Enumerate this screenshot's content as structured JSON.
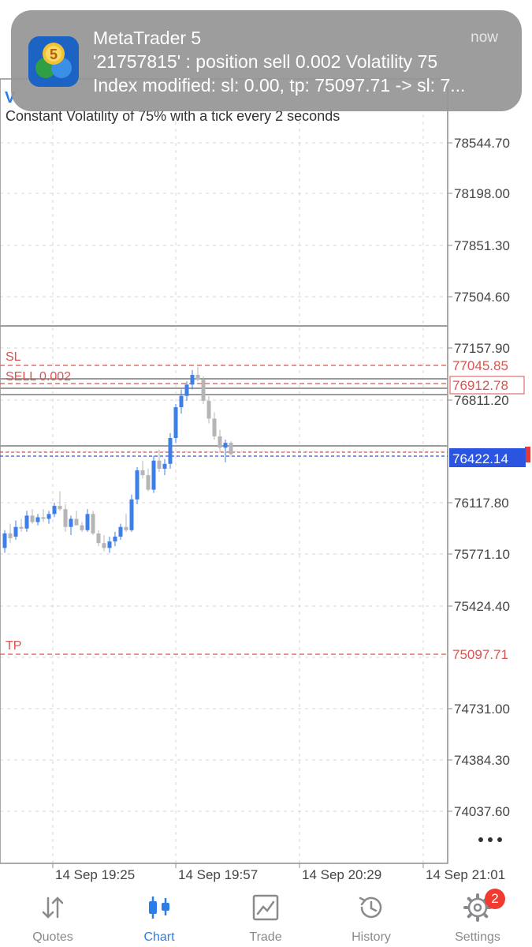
{
  "notification": {
    "app_name": "MetaTrader 5",
    "time": "now",
    "line1": "'21757815' : position sell 0.002 Volatility 75",
    "line2": "Index modified: sl: 0.00, tp: 75097.71 -> sl: 7...",
    "icon_badge": "5"
  },
  "chart": {
    "symbol_fragment": "V",
    "description": "Constant Volatility of 75% with a tick every 2 seconds",
    "price_labels": [
      "78544.70",
      "78198.00",
      "77851.30",
      "77504.60",
      "77157.90",
      "76811.20",
      "76117.80",
      "75771.10",
      "75424.40",
      "74731.00",
      "74384.30",
      "74037.60"
    ],
    "time_labels": [
      "14 Sep 19:25",
      "14 Sep 19:57",
      "14 Sep 20:29",
      "14 Sep 21:01"
    ],
    "sl": {
      "label": "SL",
      "price": "77045.85"
    },
    "sell": {
      "label": "SELL 0.002",
      "price": "76912.78"
    },
    "tp": {
      "label": "TP",
      "price": "75097.71"
    },
    "bid_price": "76422.14",
    "colors": {
      "bull": "#3d7fe8",
      "bear": "#b5b5b5",
      "order": "#d9534f",
      "bid": "#2b55e0",
      "grid": "#d6d6d6"
    }
  },
  "chart_data": {
    "type": "candlestick",
    "ylim": [
      73900,
      78750
    ],
    "candles": [
      [
        75850,
        75960,
        75820,
        75940
      ],
      [
        75940,
        76000,
        75880,
        75910
      ],
      [
        75920,
        76020,
        75900,
        75980
      ],
      [
        75980,
        76030,
        75950,
        75970
      ],
      [
        75970,
        76080,
        75950,
        76050
      ],
      [
        76050,
        76090,
        76000,
        76010
      ],
      [
        76010,
        76060,
        75990,
        76040
      ],
      [
        76040,
        76090,
        76010,
        76030
      ],
      [
        76030,
        76080,
        76000,
        76060
      ],
      [
        76060,
        76130,
        76040,
        76110
      ],
      [
        76110,
        76200,
        76080,
        76090
      ],
      [
        76090,
        76120,
        75950,
        75980
      ],
      [
        75980,
        76050,
        75930,
        76030
      ],
      [
        76030,
        76080,
        75990,
        75990
      ],
      [
        75990,
        76010,
        75950,
        75960
      ],
      [
        75960,
        76090,
        75950,
        76060
      ],
      [
        76060,
        76080,
        75930,
        75940
      ],
      [
        75940,
        75960,
        75860,
        75880
      ],
      [
        75880,
        75930,
        75830,
        75850
      ],
      [
        75850,
        75920,
        75820,
        75890
      ],
      [
        75890,
        75950,
        75860,
        75920
      ],
      [
        75920,
        76000,
        75900,
        75980
      ],
      [
        75980,
        76060,
        75950,
        75960
      ],
      [
        75960,
        76180,
        75950,
        76150
      ],
      [
        76150,
        76350,
        76120,
        76330
      ],
      [
        76330,
        76390,
        76280,
        76300
      ],
      [
        76300,
        76340,
        76200,
        76210
      ],
      [
        76210,
        76420,
        76190,
        76390
      ],
      [
        76390,
        76460,
        76320,
        76340
      ],
      [
        76340,
        76400,
        76300,
        76370
      ],
      [
        76370,
        76560,
        76340,
        76530
      ],
      [
        76530,
        76740,
        76500,
        76720
      ],
      [
        76720,
        76830,
        76680,
        76790
      ],
      [
        76790,
        76880,
        76760,
        76860
      ],
      [
        76860,
        76950,
        76830,
        76920
      ],
      [
        76920,
        76970,
        76880,
        76890
      ],
      [
        76890,
        76910,
        76740,
        76760
      ],
      [
        76760,
        76790,
        76620,
        76650
      ],
      [
        76650,
        76690,
        76520,
        76540
      ],
      [
        76540,
        76580,
        76440,
        76470
      ],
      [
        76470,
        76520,
        76380,
        76500
      ],
      [
        76500,
        76510,
        76420,
        76430
      ]
    ]
  },
  "tabs": [
    {
      "label": "Quotes",
      "icon": "arrows-up-down-icon"
    },
    {
      "label": "Chart",
      "icon": "candlestick-icon"
    },
    {
      "label": "Trade",
      "icon": "trade-chart-icon"
    },
    {
      "label": "History",
      "icon": "history-clock-icon"
    },
    {
      "label": "Settings",
      "icon": "gear-icon",
      "badge": "2"
    }
  ]
}
